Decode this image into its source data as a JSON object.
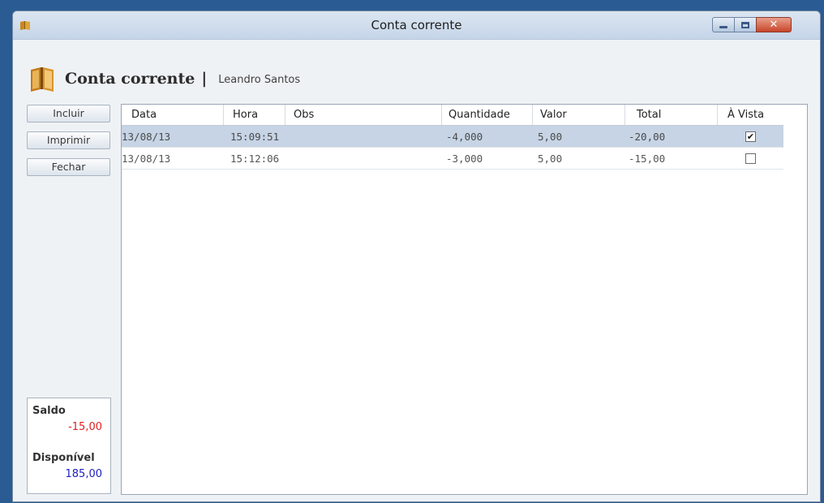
{
  "window": {
    "title": "Conta corrente",
    "close_glyph": "✕"
  },
  "header": {
    "form_title": "Conta corrente",
    "separator": "|",
    "user_name": "Leandro Santos"
  },
  "buttons": {
    "incluir": "Incluir",
    "imprimir": "Imprimir",
    "fechar": "Fechar"
  },
  "summary": {
    "saldo_label": "Saldo",
    "saldo_value": "-15,00",
    "disponivel_label": "Disponível",
    "disponivel_value": "185,00",
    "saldo_color": "#e02020",
    "disponivel_color": "#2020c0"
  },
  "grid": {
    "columns": [
      "Data",
      "Hora",
      "Obs",
      "Quantidade",
      "Valor",
      "Total",
      "À Vista"
    ],
    "rows": [
      {
        "data": "13/08/13",
        "hora": "15:09:51",
        "obs": "",
        "quantidade": "-4,000",
        "valor": "5,00",
        "total": "-20,00",
        "a_vista": true,
        "selected": true
      },
      {
        "data": "13/08/13",
        "hora": "15:12:06",
        "obs": "",
        "quantidade": "-3,000",
        "valor": "5,00",
        "total": "-15,00",
        "a_vista": false,
        "selected": false
      }
    ]
  },
  "icons": {
    "app": "book-icon",
    "header": "book-icon",
    "minimize": "minimize-icon",
    "maximize": "maximize-icon",
    "close": "close-icon",
    "check": "✔"
  },
  "colors": {
    "selected_row": "#c6d4e5",
    "title_bar": "#c5d5e8"
  }
}
